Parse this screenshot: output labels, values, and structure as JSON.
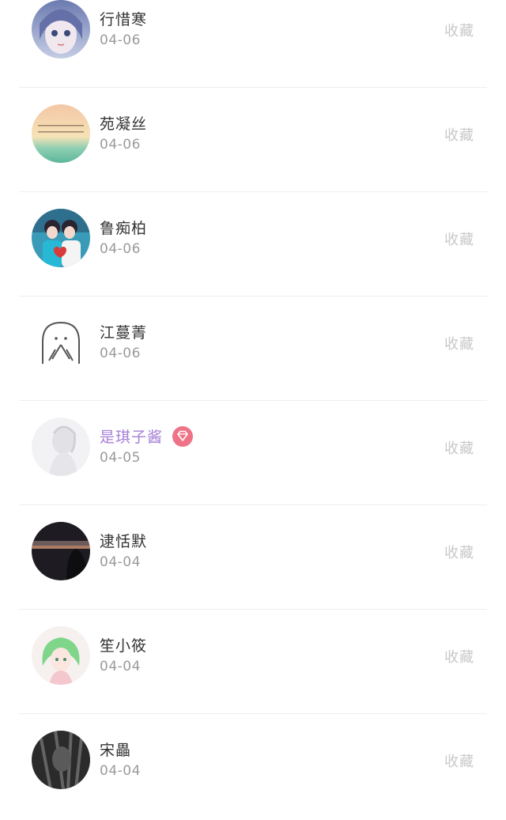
{
  "followers": [
    {
      "name": "行惜寒",
      "date": "04-06",
      "action": "收藏",
      "vip": false,
      "avatar": "anime-girl-avatar"
    },
    {
      "name": "苑凝丝",
      "date": "04-06",
      "action": "收藏",
      "vip": false,
      "avatar": "sunset-text-avatar"
    },
    {
      "name": "鲁痴柏",
      "date": "04-06",
      "action": "收藏",
      "vip": false,
      "avatar": "couple-avatar"
    },
    {
      "name": "江蔓菁",
      "date": "04-06",
      "action": "收藏",
      "vip": false,
      "avatar": "ghost-sketch-avatar"
    },
    {
      "name": "是琪子酱",
      "date": "04-05",
      "action": "收藏",
      "vip": true,
      "avatar": "faded-girl-avatar"
    },
    {
      "name": "逮恬默",
      "date": "04-04",
      "action": "收藏",
      "vip": false,
      "avatar": "dark-landscape-avatar"
    },
    {
      "name": "笙小筱",
      "date": "04-04",
      "action": "收藏",
      "vip": false,
      "avatar": "green-hair-girl-avatar"
    },
    {
      "name": "宋畾",
      "date": "04-04",
      "action": "收藏",
      "vip": false,
      "avatar": "monochrome-figure-avatar"
    }
  ],
  "colors": {
    "vip_name": "#a57fd6",
    "vip_badge": "#ef7386",
    "action_text": "#c8c8c8",
    "date_text": "#9a9a9a"
  }
}
